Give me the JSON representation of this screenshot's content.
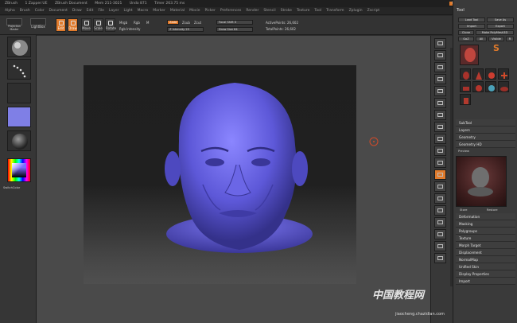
{
  "titlebar": {
    "items": [
      "ZBrush",
      "1 Zapper:UE",
      "ZBrush Document",
      "Mem 211-3021",
      "Undo 871",
      "Timer 263.75 ms"
    ],
    "right_items": [
      "Menus",
      "DefaultZScript"
    ],
    "orange": "Menus"
  },
  "menubar": {
    "items": [
      "Alpha",
      "Brush",
      "Color",
      "Document",
      "Draw",
      "Edit",
      "File",
      "Layer",
      "Light",
      "Macro",
      "Marker",
      "Material",
      "Movie",
      "Picker",
      "Preferences",
      "Render",
      "Stencil",
      "Stroke",
      "Texture",
      "Tool",
      "Transform",
      "Zplugin",
      "Zscript"
    ]
  },
  "topshelf": {
    "projection_master": "Projection Master",
    "lightbox": "LightBox",
    "edit": "Edit",
    "draw": "Draw",
    "move": "Move",
    "scale": "Scale",
    "rotate": "Rotate",
    "mrgb": "Mrgb",
    "rgb": "Rgb",
    "m": "M",
    "zadd": "Zadd",
    "zsub": "Zsub",
    "zcut": "Zcut",
    "rgb_intensity": "Rgb Intensity",
    "z_intensity": "Z Intensity 25",
    "focal_shift": "Focal Shift 0",
    "draw_size": "Draw Size 64",
    "active_points": "ActivePoints: 26,602",
    "total_points": "TotalPoints: 26,602"
  },
  "leftshelf": {
    "standard_label": "Standard",
    "dots_label": "Dots",
    "alpha_label": "Alpha Off",
    "texture_label": "Texture Off",
    "material_label": "MatCap",
    "gradient_label": "Gradient",
    "switch_color": "SwitchColor",
    "alternate": "Alternate"
  },
  "rightshelf": {
    "items": [
      "BPR",
      "SPix",
      "Scroll",
      "Zoom",
      "Actual",
      "AAHalf",
      "Persp",
      "Floor",
      "Local",
      "LSym",
      "Xyz",
      "Frame",
      "Move",
      "Scale",
      "Rotate",
      "Transp",
      "Ghost",
      "Solo",
      "Xpose"
    ]
  },
  "tray": {
    "title": "Tool",
    "buttons": [
      "Load Tool",
      "Save As",
      "Import",
      "Export",
      "Clone",
      "Make PolyMesh3D",
      "GoZ",
      "All",
      "Visible",
      "R"
    ],
    "current_tool": "Tooth_80",
    "sections": [
      "SubTool",
      "Layers",
      "Geometry",
      "Geometry HD",
      "Preview",
      "Deformation",
      "Masking",
      "Polygroups",
      "Texture",
      "Morph Target",
      "Displacement",
      "NormalMap",
      "Unified Skin",
      "Display Properties",
      "Import"
    ],
    "preview_label": "Preview",
    "store": "Store",
    "restore": "Restore"
  },
  "watermark": {
    "text": "中国教程网",
    "url": "jiaocheng.chazidian.com"
  }
}
